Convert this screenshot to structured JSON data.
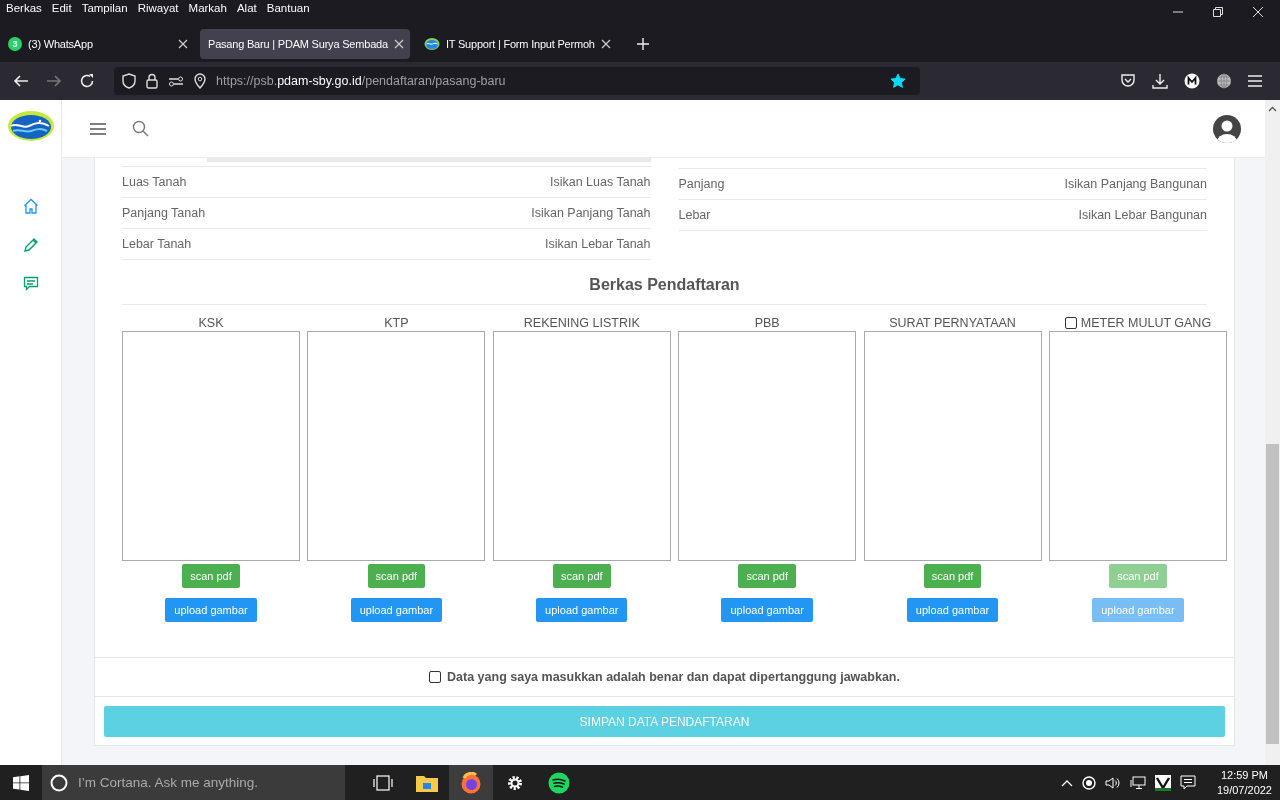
{
  "browser": {
    "menu": [
      "Berkas",
      "Edit",
      "Tampilan",
      "Riwayat",
      "Markah",
      "Alat",
      "Bantuan"
    ],
    "tabs": [
      {
        "kind": "whatsapp",
        "badge": "3",
        "title": "(3) WhatsApp",
        "selected": false
      },
      {
        "kind": "none",
        "title": "Pasang Baru | PDAM Surya Sembada",
        "selected": true
      },
      {
        "kind": "site",
        "title": "IT Support | Form Input Permoh",
        "selected": false
      }
    ],
    "url": {
      "prefix": "https://psb.",
      "domain": "pdam-sby.go.id",
      "path": "/pendaftaran/pasang-baru"
    },
    "bookmarked": true
  },
  "page": {
    "left_fields": [
      {
        "label": "Luas Tanah",
        "placeholder": "Isikan Luas Tanah"
      },
      {
        "label": "Panjang Tanah",
        "placeholder": "Isikan Panjang Tanah"
      },
      {
        "label": "Lebar Tanah",
        "placeholder": "Isikan Lebar Tanah"
      }
    ],
    "right_fields": [
      {
        "label": "Panjang",
        "placeholder": "Isikan Panjang Bangunan"
      },
      {
        "label": "Lebar",
        "placeholder": "Isikan Lebar Bangunan"
      }
    ],
    "section_title": "Berkas Pendaftaran",
    "documents": [
      {
        "kind": "plain",
        "title": "KSK",
        "disabled": false,
        "scan_label": "scan pdf",
        "upload_label": "upload gambar"
      },
      {
        "kind": "plain",
        "title": "KTP",
        "disabled": false,
        "scan_label": "scan pdf",
        "upload_label": "upload gambar"
      },
      {
        "kind": "plain",
        "title": "REKENING LISTRIK",
        "disabled": false,
        "scan_label": "scan pdf",
        "upload_label": "upload gambar"
      },
      {
        "kind": "plain",
        "title": "PBB",
        "disabled": false,
        "scan_label": "scan pdf",
        "upload_label": "upload gambar"
      },
      {
        "kind": "plain",
        "title": "SURAT PERNYATAAN",
        "disabled": false,
        "scan_label": "scan pdf",
        "upload_label": "upload gambar"
      },
      {
        "kind": "checkbox",
        "title": "METER MULUT GANG",
        "checked": false,
        "disabled": true,
        "scan_label": "scan pdf",
        "upload_label": "upload gambar"
      }
    ],
    "agreement": {
      "text": "Data yang saya masukkan adalah benar dan dapat dipertanggung jawabkan.",
      "checked": false
    },
    "submit_label": "SIMPAN DATA PENDAFTARAN"
  },
  "taskbar": {
    "search_placeholder": "I’m Cortana. Ask me anything.",
    "time": "12:59 PM",
    "date": "19/07/2022"
  }
}
